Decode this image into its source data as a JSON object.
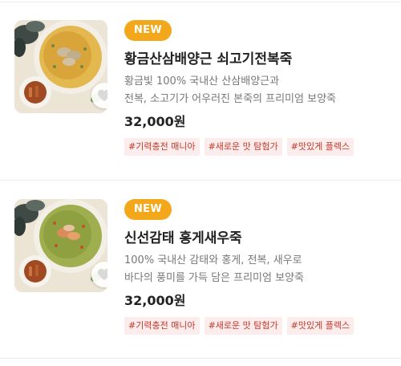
{
  "products": [
    {
      "badge": "NEW",
      "title": "황금산삼배양근 쇠고기전복죽",
      "desc_line1": "황금빛 100% 국내산 산삼배양근과",
      "desc_line2": "전복, 소고기가 어우러진 본죽의 프리미엄 보양죽",
      "price": "32,000원",
      "tags": [
        "#기력충전 매니아",
        "#새로운 맛 탐험가",
        "#맛있게 플렉스"
      ]
    },
    {
      "badge": "NEW",
      "title": "신선감태 홍게새우죽",
      "desc_line1": "100% 국내산 감태와 홍게, 전복, 새우로",
      "desc_line2": "바다의 풍미를 가득 담은 프리미엄 보양죽",
      "price": "32,000원",
      "tags": [
        "#기력충전 매니아",
        "#새로운 맛 탐험가",
        "#맛있게 플렉스"
      ]
    }
  ],
  "colors": {
    "badge": "#f3a81b",
    "tag_bg": "#fdecec",
    "tag_text": "#c0392b",
    "divider": "#ededed"
  },
  "icons": {
    "wishlist": "heart-icon"
  }
}
